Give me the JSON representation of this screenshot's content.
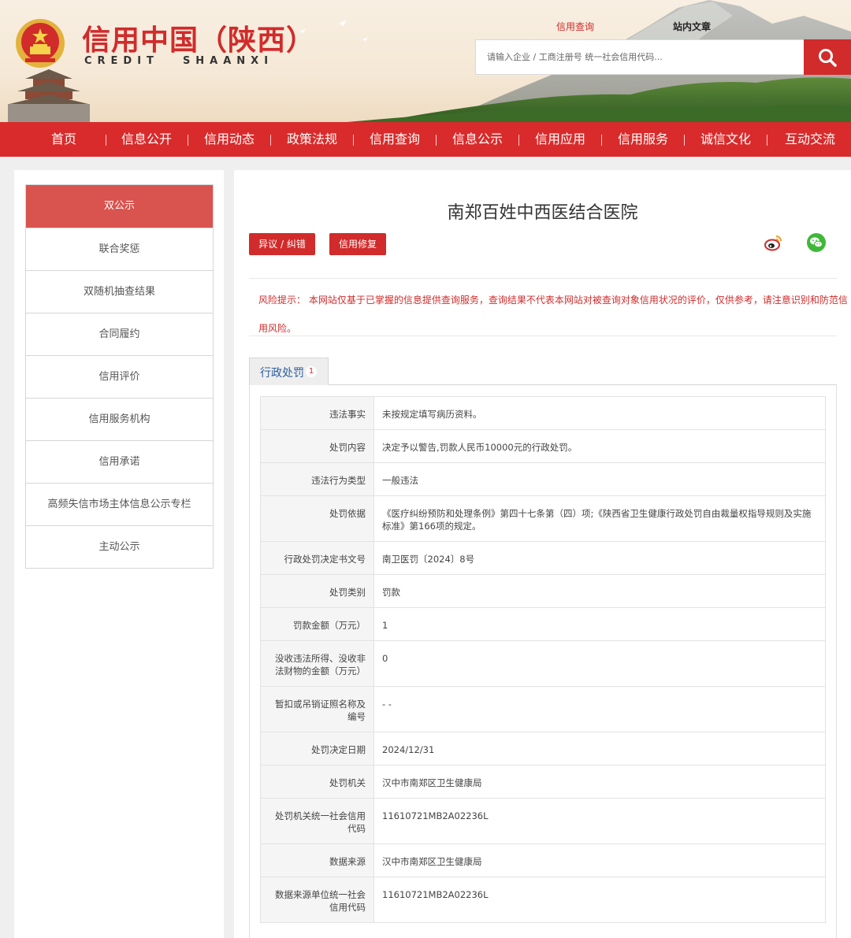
{
  "header": {
    "title": "信用中国（陕西）",
    "title_en_left": "CREDIT",
    "title_en_right": "SHAANXI",
    "search_tabs": [
      "信用查询",
      "站内文章"
    ],
    "search_placeholder": "请输入企业 / 工商注册号 统一社会信用代码...",
    "brand_color": "#d12b2b"
  },
  "nav": {
    "items": [
      "首页",
      "信息公开",
      "信用动态",
      "政策法规",
      "信用查询",
      "信息公示",
      "信用应用",
      "信用服务",
      "诚信文化",
      "互动交流"
    ]
  },
  "sidebar": {
    "items": [
      "双公示",
      "联合奖惩",
      "双随机抽查结果",
      "合同履约",
      "信用评价",
      "信用服务机构",
      "信用承诺",
      "高频失信市场主体信息公示专栏",
      "主动公示"
    ],
    "active_index": 0
  },
  "main": {
    "title": "南郑百姓中西医结合医院",
    "buttons": [
      "异议 / 纠错",
      "信用修复"
    ],
    "share_icons": [
      "weibo-icon",
      "wechat-icon"
    ],
    "risk_notice_line1": "风险提示： 本网站仅基于已掌握的信息提供查询服务，查询结果不代表本网站对被查询对象信用状况的评价，仅供参考，请注意识别和防范信",
    "risk_notice_line2": "用风险。",
    "tab": {
      "label": "行政处罚",
      "count": "1"
    },
    "rows": [
      {
        "key": "违法事实",
        "value": "未按规定填写病历资料。"
      },
      {
        "key": "处罚内容",
        "value": "决定予以警告,罚款人民币10000元的行政处罚。"
      },
      {
        "key": "违法行为类型",
        "value": "一般违法"
      },
      {
        "key": "处罚依据",
        "value": "《医疗纠纷预防和处理条例》第四十七条第（四）项;《陕西省卫生健康行政处罚自由裁量权指导规则及实施标准》第166项的规定。"
      },
      {
        "key": "行政处罚决定书文号",
        "value": "南卫医罚〔2024〕8号"
      },
      {
        "key": "处罚类别",
        "value": "罚款"
      },
      {
        "key": "罚款金额（万元）",
        "value": "1"
      },
      {
        "key": "没收违法所得、没收非法财物的金额（万元）",
        "value": "0"
      },
      {
        "key": "暂扣或吊销证照名称及编号",
        "value": "- -"
      },
      {
        "key": "处罚决定日期",
        "value": "2024/12/31"
      },
      {
        "key": "处罚机关",
        "value": "汉中市南郑区卫生健康局"
      },
      {
        "key": "处罚机关统一社会信用代码",
        "value": "11610721MB2A02236L"
      },
      {
        "key": "数据来源",
        "value": "汉中市南郑区卫生健康局"
      },
      {
        "key": "数据来源单位统一社会信用代码",
        "value": "11610721MB2A02236L"
      }
    ]
  }
}
